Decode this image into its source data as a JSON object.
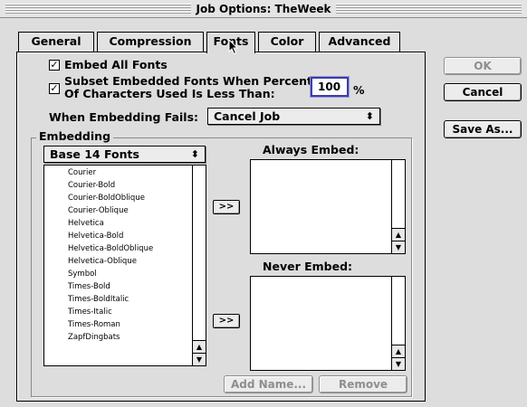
{
  "window": {
    "title": "Job Options: TheWeek"
  },
  "tabs": [
    {
      "label": "General"
    },
    {
      "label": "Compression"
    },
    {
      "label": "Fonts"
    },
    {
      "label": "Color"
    },
    {
      "label": "Advanced"
    }
  ],
  "fonts_tab": {
    "embed_all": {
      "label": "Embed All Fonts",
      "checked": true
    },
    "subset": {
      "label_line1": "Subset Embedded Fonts When Percent",
      "label_line2": "Of Characters Used Is Less Than:",
      "checked": true,
      "value": "100",
      "unit": "%"
    },
    "when_fails": {
      "label": "When Embedding Fails:",
      "selected": "Cancel Job"
    },
    "embedding": {
      "group_label": "Embedding",
      "font_source": {
        "selected": "Base 14 Fonts"
      },
      "font_list": [
        "Courier",
        "Courier-Bold",
        "Courier-BoldOblique",
        "Courier-Oblique",
        "Helvetica",
        "Helvetica-Bold",
        "Helvetica-BoldOblique",
        "Helvetica-Oblique",
        "Symbol",
        "Times-Bold",
        "Times-BoldItalic",
        "Times-Italic",
        "Times-Roman",
        "ZapfDingbats"
      ],
      "move_button_label": ">>",
      "always_embed_label": "Always Embed:",
      "never_embed_label": "Never Embed:",
      "add_name_label": "Add Name...",
      "remove_label": "Remove"
    }
  },
  "buttons": {
    "ok": "OK",
    "cancel": "Cancel",
    "save_as": "Save As..."
  }
}
